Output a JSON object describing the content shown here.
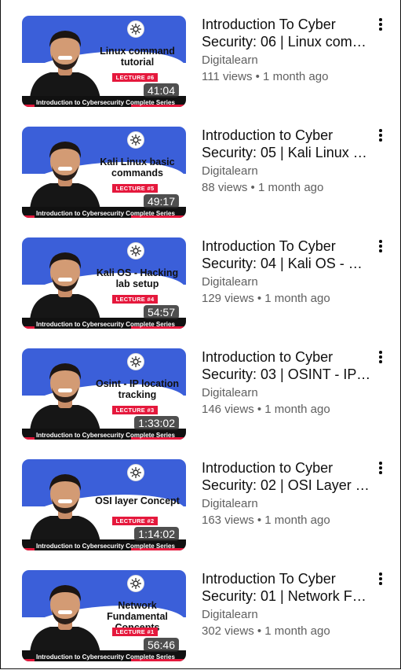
{
  "videos": [
    {
      "topic_line1": "Linux command",
      "topic_line2": "tutorial",
      "lecture": "LECTURE #6",
      "duration": "41:04",
      "title_line1": "Introduction To Cyber",
      "title_line2": "Security: 06 | Linux com…",
      "channel": "Digitalearn",
      "meta": "111 views • 1 month ago",
      "series": "Introduction to Cybersecurity Complete Series"
    },
    {
      "topic_line1": "Kali Linux basic",
      "topic_line2": "commands",
      "lecture": "LECTURE #5",
      "duration": "49:17",
      "title_line1": "Introduction to Cyber",
      "title_line2": "Security: 05 | Kali Linux …",
      "channel": "Digitalearn",
      "meta": "88 views • 1 month ago",
      "series": "Introduction to Cybersecurity Complete Series"
    },
    {
      "topic_line1": "Kali OS - Hacking",
      "topic_line2": "lab setup",
      "lecture": "LECTURE #4",
      "duration": "54:57",
      "title_line1": "Introduction To Cyber",
      "title_line2": "Security: 04 | Kali OS - H…",
      "channel": "Digitalearn",
      "meta": "129 views • 1 month ago",
      "series": "Introduction to Cybersecurity Complete Series"
    },
    {
      "topic_line1": "Osint - IP location",
      "topic_line2": "tracking",
      "lecture": "LECTURE #3",
      "duration": "1:33:02",
      "title_line1": "Introduction to Cyber",
      "title_line2": "Security: 03 | OSINT - IP …",
      "channel": "Digitalearn",
      "meta": "146 views • 1 month ago",
      "series": "Introduction to Cybersecurity Complete Series"
    },
    {
      "topic_line1": "OSI layer Concept",
      "topic_line2": "",
      "lecture": "LECTURE #2",
      "duration": "1:14:02",
      "title_line1": "Introduction to Cyber",
      "title_line2": "Security: 02 | OSI Layer …",
      "channel": "Digitalearn",
      "meta": "163 views • 1 month ago",
      "series": "Introduction to Cybersecurity Complete Series"
    },
    {
      "topic_line1": "Network Fundamental",
      "topic_line2": "Concepts",
      "lecture": "LECTURE #1",
      "duration": "56:46",
      "title_line1": "Introduction To Cyber",
      "title_line2": "Security: 01 | Network F…",
      "channel": "Digitalearn",
      "meta": "302 views • 1 month ago",
      "series": "Introduction to Cybersecurity Complete Series"
    }
  ],
  "colors": {
    "thumb_blue": "#3b5fd9",
    "lecture_red": "#e5183c",
    "secondary_text": "#606060"
  },
  "icons": {
    "more": "more-vert-icon",
    "logo": "cyber-logo-icon"
  }
}
